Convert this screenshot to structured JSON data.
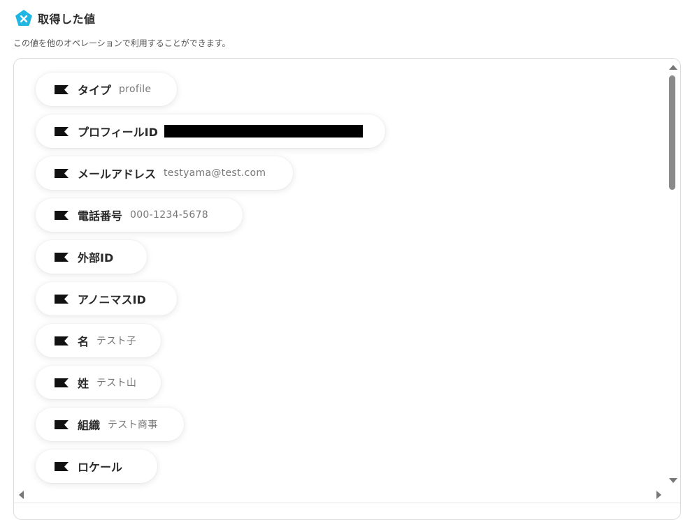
{
  "header": {
    "title": "取得した値",
    "icon": "yoom-x-pentagon-icon",
    "icon_color": "#1fb6e4"
  },
  "subtitle": "この値を他のオペレーションで利用することができます。",
  "items": [
    {
      "label": "タイプ",
      "value": "profile"
    },
    {
      "label": "プロフィールID",
      "value": "",
      "redacted": true
    },
    {
      "label": "メールアドレス",
      "value": "testyama@test.com"
    },
    {
      "label": "電話番号",
      "value": "000-1234-5678"
    },
    {
      "label": "外部ID",
      "value": ""
    },
    {
      "label": "アノニマスID",
      "value": ""
    },
    {
      "label": "名",
      "value": "テスト子"
    },
    {
      "label": "姓",
      "value": "テスト山"
    },
    {
      "label": "組織",
      "value": "テスト商事"
    },
    {
      "label": "ロケール",
      "value": ""
    }
  ]
}
